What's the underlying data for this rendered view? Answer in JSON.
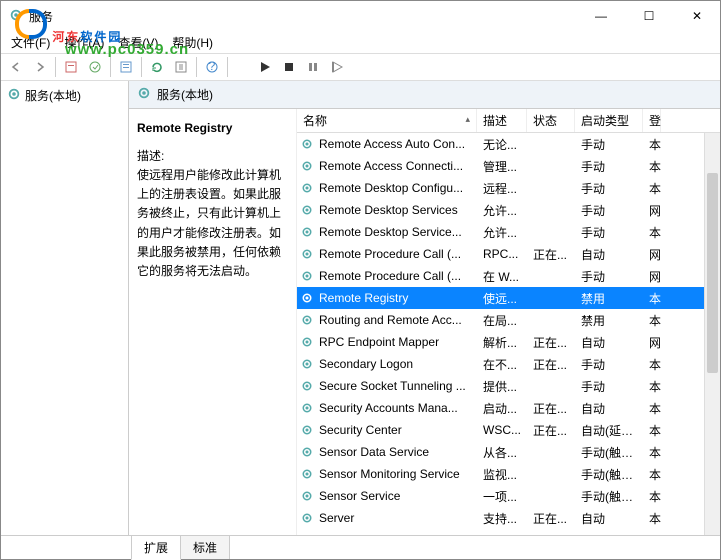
{
  "window": {
    "title": "服务"
  },
  "watermark": {
    "text1": "河东",
    "text2": "软件园",
    "url": "www.pc0359.cn"
  },
  "menu": {
    "file": "文件(F)",
    "action": "操作(A)",
    "view": "查看(V)",
    "help": "帮助(H)"
  },
  "left": {
    "item": "服务(本地)"
  },
  "right_header": "服务(本地)",
  "detail": {
    "title": "Remote Registry",
    "desc_label": "描述:",
    "desc": "使远程用户能修改此计算机上的注册表设置。如果此服务被终止，只有此计算机上的用户才能修改注册表。如果此服务被禁用，任何依赖它的服务将无法启动。"
  },
  "columns": {
    "name": "名称",
    "desc": "描述",
    "status": "状态",
    "startup": "启动类型",
    "last": "登"
  },
  "services": [
    {
      "name": "Remote Access Auto Con...",
      "desc": "无论...",
      "status": "",
      "startup": "手动",
      "l": "本"
    },
    {
      "name": "Remote Access Connecti...",
      "desc": "管理...",
      "status": "",
      "startup": "手动",
      "l": "本"
    },
    {
      "name": "Remote Desktop Configu...",
      "desc": "远程...",
      "status": "",
      "startup": "手动",
      "l": "本"
    },
    {
      "name": "Remote Desktop Services",
      "desc": "允许...",
      "status": "",
      "startup": "手动",
      "l": "网"
    },
    {
      "name": "Remote Desktop Service...",
      "desc": "允许...",
      "status": "",
      "startup": "手动",
      "l": "本"
    },
    {
      "name": "Remote Procedure Call (...",
      "desc": "RPC...",
      "status": "正在...",
      "startup": "自动",
      "l": "网"
    },
    {
      "name": "Remote Procedure Call (...",
      "desc": "在 W...",
      "status": "",
      "startup": "手动",
      "l": "网"
    },
    {
      "name": "Remote Registry",
      "desc": "使远...",
      "status": "",
      "startup": "禁用",
      "l": "本",
      "selected": true
    },
    {
      "name": "Routing and Remote Acc...",
      "desc": "在局...",
      "status": "",
      "startup": "禁用",
      "l": "本"
    },
    {
      "name": "RPC Endpoint Mapper",
      "desc": "解析...",
      "status": "正在...",
      "startup": "自动",
      "l": "网"
    },
    {
      "name": "Secondary Logon",
      "desc": "在不...",
      "status": "正在...",
      "startup": "手动",
      "l": "本"
    },
    {
      "name": "Secure Socket Tunneling ...",
      "desc": "提供...",
      "status": "",
      "startup": "手动",
      "l": "本"
    },
    {
      "name": "Security Accounts Mana...",
      "desc": "启动...",
      "status": "正在...",
      "startup": "自动",
      "l": "本"
    },
    {
      "name": "Security Center",
      "desc": "WSC...",
      "status": "正在...",
      "startup": "自动(延迟...",
      "l": "本"
    },
    {
      "name": "Sensor Data Service",
      "desc": "从各...",
      "status": "",
      "startup": "手动(触发...",
      "l": "本"
    },
    {
      "name": "Sensor Monitoring Service",
      "desc": "监视...",
      "status": "",
      "startup": "手动(触发...",
      "l": "本"
    },
    {
      "name": "Sensor Service",
      "desc": "一项...",
      "status": "",
      "startup": "手动(触发...",
      "l": "本"
    },
    {
      "name": "Server",
      "desc": "支持...",
      "status": "正在...",
      "startup": "自动",
      "l": "本"
    }
  ],
  "tabs": {
    "extended": "扩展",
    "standard": "标准"
  }
}
